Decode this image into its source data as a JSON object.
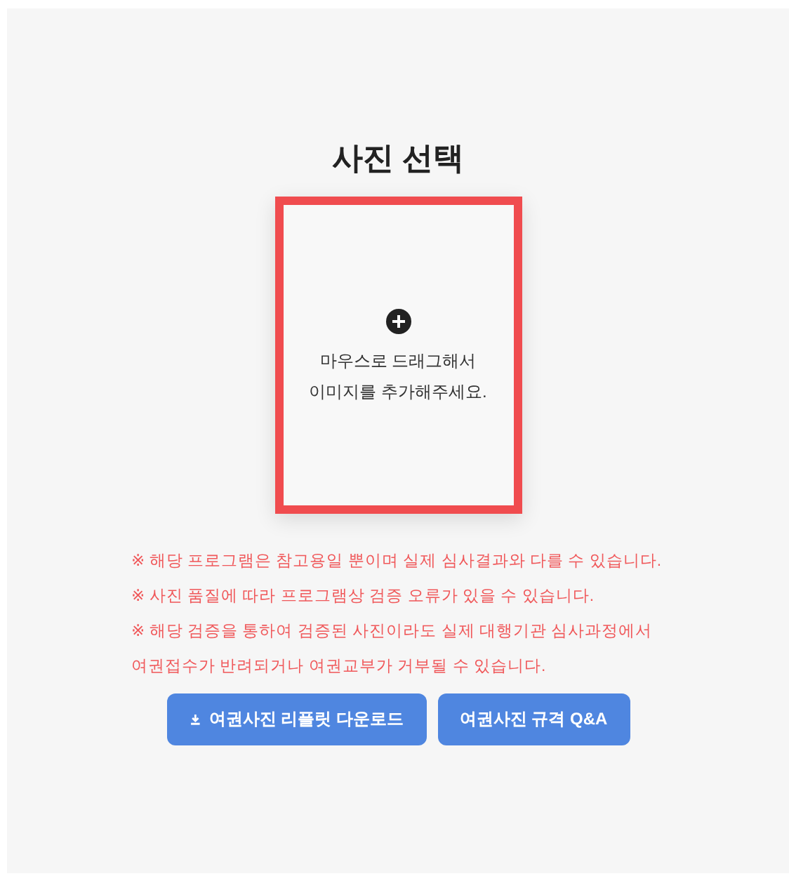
{
  "title": "사진 선택",
  "dropzone": {
    "lines": [
      "마우스로 드래그해서",
      "이미지를 추가해주세요."
    ]
  },
  "notices": [
    "※ 해당 프로그램은 참고용일 뿐이며 실제 심사결과와 다를 수 있습니다.",
    "※ 사진 품질에 따라 프로그램상 검증 오류가 있을 수 있습니다.",
    "※ 해당 검증을 통하여 검증된 사진이라도 실제 대행기관 심사과정에서 여권접수가 반려되거나 여권교부가 거부될 수 있습니다."
  ],
  "buttons": [
    {
      "label": "여권사진 리플릿 다운로드",
      "kind": "download"
    },
    {
      "label": "여권사진 규격 Q&A",
      "kind": "link"
    }
  ]
}
